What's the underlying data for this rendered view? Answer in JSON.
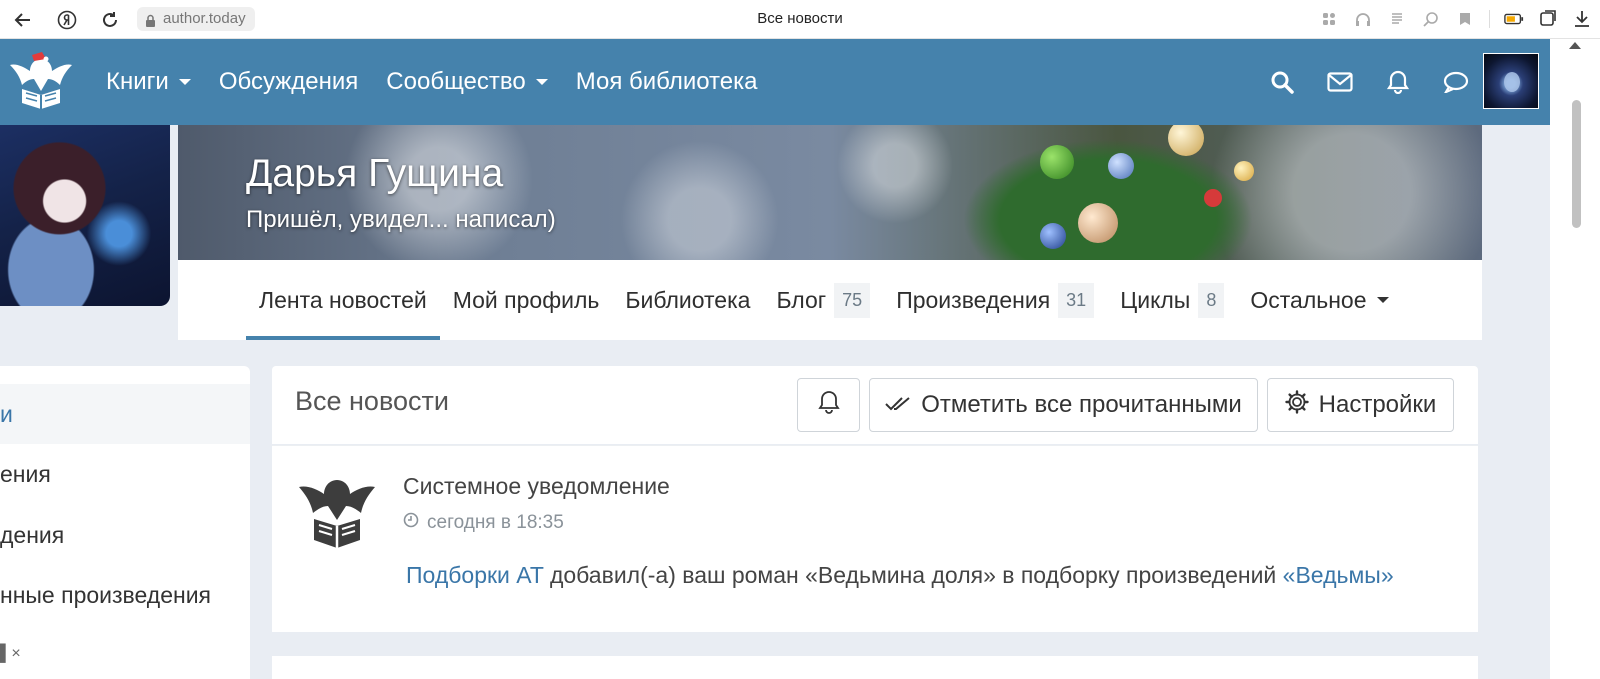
{
  "browser": {
    "url": "author.today",
    "title": "Все новости"
  },
  "navbar": {
    "menu": [
      {
        "label": "Книги",
        "dropdown": true
      },
      {
        "label": "Обсуждения",
        "dropdown": false
      },
      {
        "label": "Сообщество",
        "dropdown": true
      },
      {
        "label": "Моя библиотека",
        "dropdown": false
      }
    ],
    "icons": [
      "search-icon",
      "mail-icon",
      "bell-icon",
      "chat-icon"
    ],
    "accent": "#4582ac"
  },
  "profile": {
    "name": "Дарья Гущина",
    "status": "Пришёл, увидел... написал)",
    "tabs": [
      {
        "label": "Лента новостей",
        "count": "",
        "active": true
      },
      {
        "label": "Мой профиль",
        "count": ""
      },
      {
        "label": "Библиотека",
        "count": ""
      },
      {
        "label": "Блог",
        "count": "75"
      },
      {
        "label": "Произведения",
        "count": "31"
      },
      {
        "label": "Циклы",
        "count": "8"
      },
      {
        "label": "Остальное",
        "count": "",
        "dropdown": true
      }
    ]
  },
  "sidebar": {
    "items": [
      {
        "label": "и",
        "active": true
      },
      {
        "label": "ения"
      },
      {
        "label": "дения"
      },
      {
        "label": "нные произведения"
      }
    ],
    "extra": "▌×"
  },
  "news": {
    "title": "Все новости",
    "mark_read_label": "Отметить все прочитанными",
    "settings_label": "Настройки",
    "item": {
      "author": "Системное уведомление",
      "time": "сегодня в 18:35",
      "link1": "Подборки AT",
      "text": " добавил(-а) ваш роман «Ведьмина доля» в подборку произведений ",
      "link2": "«Ведьмы»"
    }
  }
}
